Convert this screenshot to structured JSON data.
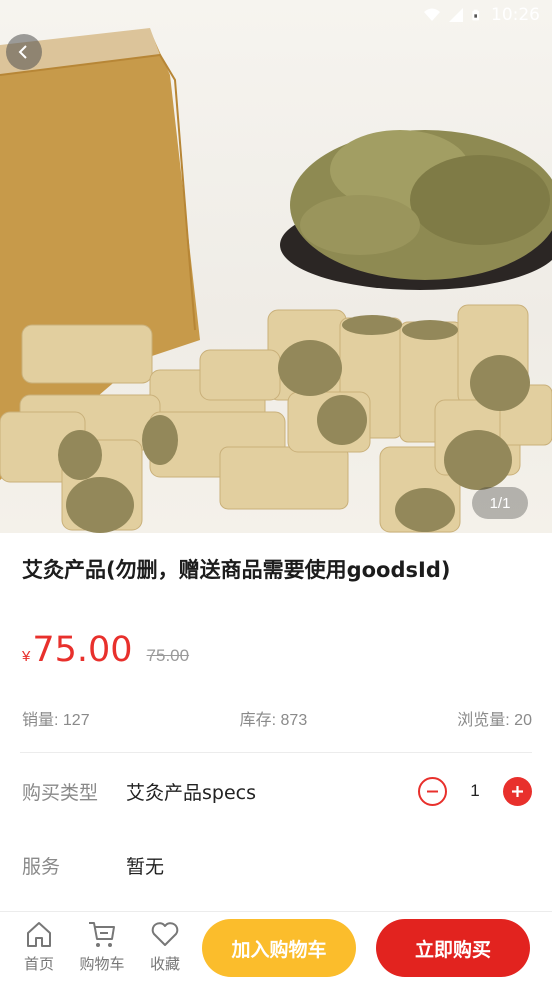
{
  "status_bar": {
    "time": "10:26",
    "icons": [
      "wifi-icon",
      "signal-icon",
      "battery-icon"
    ]
  },
  "gallery": {
    "indicator": "1/1",
    "image_subject": "moxa-cylinders-and-herb-bowl"
  },
  "product": {
    "title": "艾灸产品(勿删，赠送商品需要使用goodsId)",
    "currency": "¥",
    "price": "75.00",
    "original_price": "75.00"
  },
  "stats": {
    "sales": "销量: 127",
    "stock": "库存: 873",
    "views": "浏览量: 20"
  },
  "purchase": {
    "type_label": "购买类型",
    "type_value": "艾灸产品specs",
    "quantity": "1"
  },
  "service": {
    "label": "服务",
    "value": "暂无"
  },
  "bottom_nav": {
    "home": "首页",
    "cart": "购物车",
    "favorite": "收藏"
  },
  "actions": {
    "add_to_cart": "加入购物车",
    "buy_now": "立即购买"
  },
  "colors": {
    "accent_red": "#e2231f",
    "price_red": "#e8302c",
    "cart_yellow": "#fbbd2c"
  }
}
